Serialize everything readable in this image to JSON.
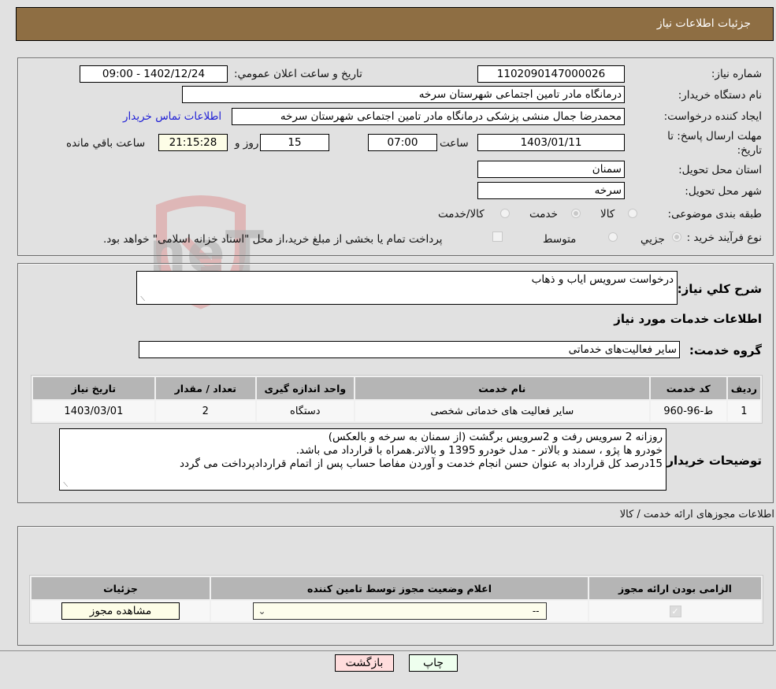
{
  "header": {
    "title": "جزئیات اطلاعات نیاز"
  },
  "details": {
    "need_number_label": "شماره نیاز:",
    "need_number": "1102090147000026",
    "announce_label": "تاریخ و ساعت اعلان عمومي:",
    "announce_value": "1402/12/24 - 09:00",
    "buyer_org_label": "نام دستگاه خریدار:",
    "buyer_org": "درمانگاه مادر تامین اجتماعی شهرستان سرخه",
    "creator_label": "ایجاد کننده درخواست:",
    "creator": "محمدرضا جمال منشی پزشکی درمانگاه مادر تامین اجتماعی شهرستان سرخه",
    "contact_link": "اطلاعات تماس خریدار",
    "deadline_label_1": "مهلت ارسال پاسخ: تا",
    "deadline_label_2": "تاریخ:",
    "deadline_date": "1403/01/11",
    "time_label": "ساعت",
    "deadline_time": "07:00",
    "days_value": "15",
    "days_label": "روز و",
    "remaining_time": "21:15:28",
    "remaining_label": "ساعت باقي مانده",
    "province_label": "استان محل تحویل:",
    "province": "سمنان",
    "city_label": "شهر محل تحویل:",
    "city": "سرخه",
    "category_label": "طبقه بندی موضوعی:",
    "category_options": [
      {
        "label": "کالا",
        "selected": false
      },
      {
        "label": "خدمت",
        "selected": true
      },
      {
        "label": "کالا/خدمت",
        "selected": false
      }
    ],
    "process_label": "نوع فرآیند خرید :",
    "process_options": [
      {
        "label": "جزيي",
        "selected": true
      },
      {
        "label": "متوسط",
        "selected": false
      }
    ],
    "treasury_checkbox_label": "پرداخت تمام یا بخشی از مبلغ خرید،از محل \"اسناد خزانه اسلامی\" خواهد بود.",
    "treasury_checked": false
  },
  "summary": {
    "description_label": "شرح کلي نیاز:",
    "description": "درخواست سرویس ایاب و ذهاب",
    "services_title": "اطلاعات خدمات مورد نیاز",
    "service_group_label": "گروه خدمت:",
    "service_group": "سایر فعالیت‌های خدماتی"
  },
  "services_table": {
    "headers": [
      "ردیف",
      "کد خدمت",
      "نام خدمت",
      "واحد اندازه گیری",
      "تعداد / مقدار",
      "تاریخ نیاز"
    ],
    "rows": [
      [
        "1",
        "ط-96-960",
        "سایر فعالیت های خدماتی شخصی",
        "دستگاه",
        "2",
        "1403/03/01"
      ]
    ]
  },
  "buyer_notes": {
    "label": "توضیحات خریدار:",
    "lines": [
      "روزانه 2 سرویس رفت و 2سرویس برگشت (از سمنان به سرخه و بالعکس)",
      "خودرو ها پژو ، سمند و بالاتر - مدل خودرو 1395 و بالاتر.همراه با قرارداد می باشد.",
      "15درصد کل قرارداد به عنوان حسن انجام خدمت و آوردن مفاصا حساب  پس از اتمام قراردادپرداخت می گردد"
    ]
  },
  "permits": {
    "section_title": "اطلاعات مجوزهای ارائه خدمت / کالا",
    "headers": [
      "الزامی بودن ارائه مجوز",
      "اعلام وضعیت مجوز توسط تامین کننده",
      "جزئیات"
    ],
    "row": {
      "required_checked": true,
      "status_selected": "--",
      "details_button": "مشاهده مجوز"
    }
  },
  "footer": {
    "print_button": "چاپ",
    "back_button": "بازگشت"
  },
  "watermark": {
    "text": "AriaTender.neT"
  },
  "colors": {
    "header_bg": "#8e6e43",
    "print_bg": "#eeffee",
    "back_bg": "#ffdddd"
  }
}
